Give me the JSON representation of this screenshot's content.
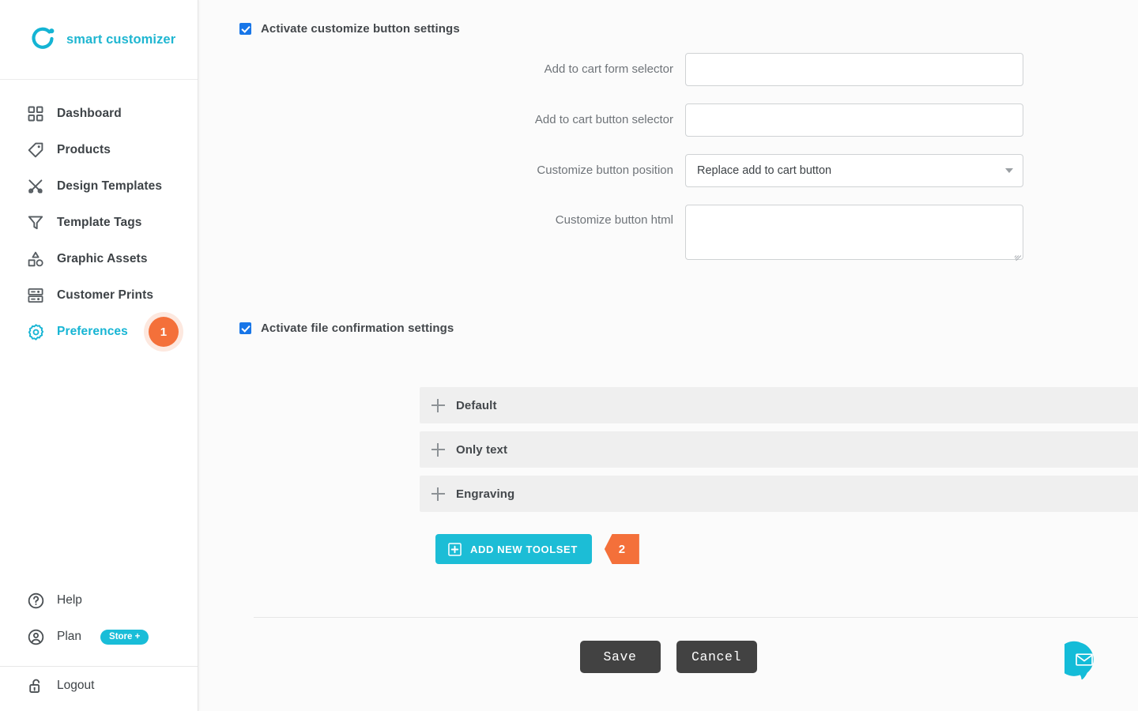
{
  "brand": {
    "name": "smart customizer",
    "logo_icon": "smart-customizer-logo",
    "accent_color": "#1fb6d1"
  },
  "sidebar": {
    "items": [
      {
        "label": "Dashboard",
        "icon": "grid-icon",
        "active": false
      },
      {
        "label": "Products",
        "icon": "tag-icon",
        "active": false
      },
      {
        "label": "Design Templates",
        "icon": "design-tools-icon",
        "active": false
      },
      {
        "label": "Template Tags",
        "icon": "funnel-icon",
        "active": false
      },
      {
        "label": "Graphic Assets",
        "icon": "shapes-icon",
        "active": false
      },
      {
        "label": "Customer Prints",
        "icon": "print-layers-icon",
        "active": false
      },
      {
        "label": "Preferences",
        "icon": "gear-icon",
        "active": true,
        "badge": "1"
      }
    ],
    "bottom": {
      "help_label": "Help",
      "help_icon": "question-circle-icon",
      "plan_label": "Plan",
      "plan_icon": "user-circle-icon",
      "plan_pill": "Store +",
      "logout_label": "Logout",
      "logout_icon": "unlock-icon"
    },
    "badge_color": "#f4703a"
  },
  "main": {
    "customize_button_settings": {
      "checkbox_label": "Activate customize button settings",
      "checked": true,
      "fields": [
        {
          "label": "Add to cart form selector",
          "type": "text",
          "value": "",
          "placeholder": ""
        },
        {
          "label": "Add to cart button selector",
          "type": "text",
          "value": "",
          "placeholder": ""
        },
        {
          "label": "Customize button position",
          "type": "select",
          "value": "Replace add to cart button"
        },
        {
          "label": "Customize button html",
          "type": "textarea",
          "value": "",
          "placeholder": ""
        }
      ]
    },
    "file_confirmation_settings": {
      "checkbox_label": "Activate file confirmation settings",
      "checked": true
    },
    "accordion": [
      {
        "title": "Default",
        "expanded": false,
        "icon": "plus-icon"
      },
      {
        "title": "Only text",
        "expanded": false,
        "icon": "plus-icon"
      },
      {
        "title": "Engraving",
        "expanded": false,
        "icon": "plus-icon"
      }
    ],
    "add_toolset": {
      "label": "ADD NEW TOOLSET",
      "icon": "add-square-icon",
      "badge": "2",
      "color": "#1cbdd6"
    },
    "actions": {
      "save_label": "Save",
      "cancel_label": "Cancel"
    },
    "chat_fab": {
      "icon": "envelope-chat-icon",
      "color": "#1cbdd6"
    }
  }
}
